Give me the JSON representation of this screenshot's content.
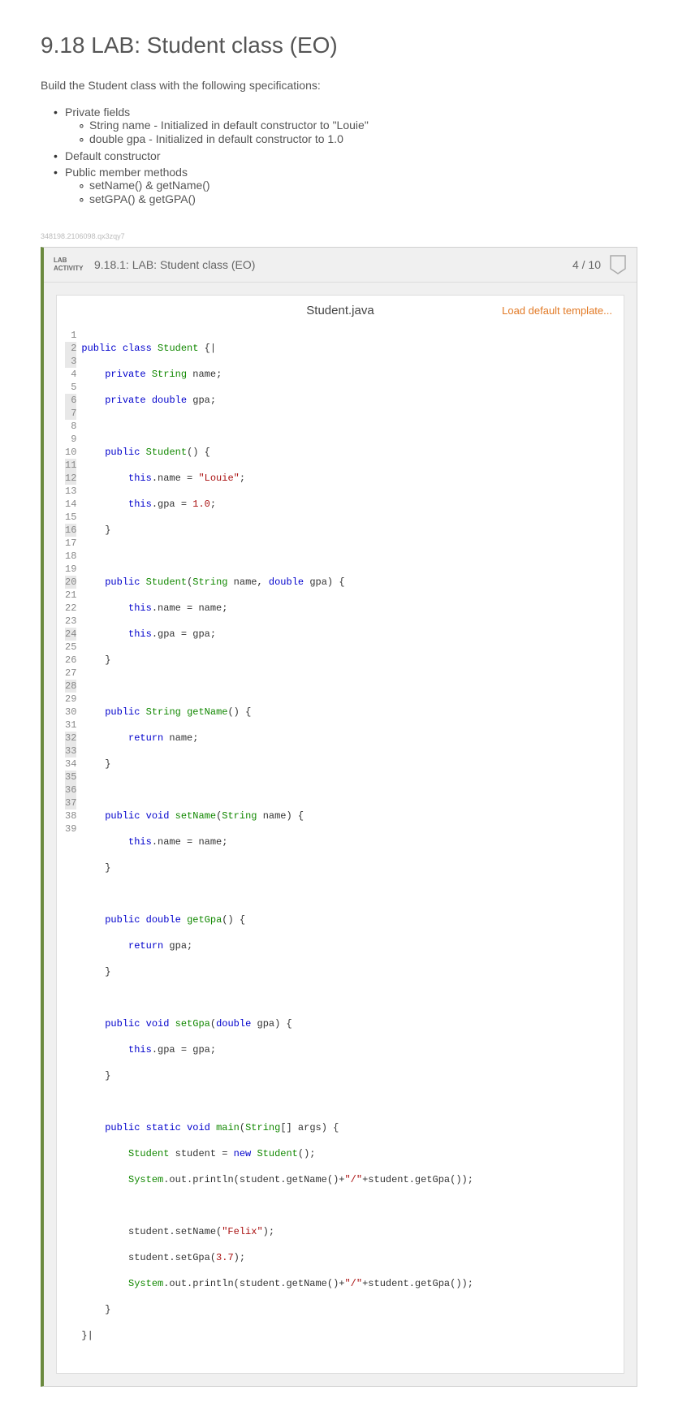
{
  "heading": "9.18 LAB: Student class (EO)",
  "description": "Build the Student class with the following specifications:",
  "specs": {
    "item1": "Private fields",
    "item1a": "String name - Initialized in default constructor to \"Louie\"",
    "item1b": "double gpa - Initialized in default constructor to 1.0",
    "item2": "Default constructor",
    "item3": "Public member methods",
    "item3a": "setName() & getName()",
    "item3b": "setGPA() & getGPA()"
  },
  "hash": "348198.2106098.qx3zqy7",
  "activity": {
    "label_line1": "LAB",
    "label_line2": "ACTIVITY",
    "title": "9.18.1: LAB: Student class (EO)",
    "score": "4 / 10"
  },
  "editor": {
    "filename": "Student.java",
    "load_template": "Load default template..."
  },
  "code_lines": 39,
  "code_tokens": {
    "l1": {
      "a": "public",
      "b": "class",
      "c": "Student",
      "d": "{|"
    },
    "l2": {
      "a": "private",
      "b": "String",
      "c": "name;"
    },
    "l3": {
      "a": "private",
      "b": "double",
      "c": "gpa;"
    },
    "l5": {
      "a": "public",
      "b": "Student",
      "c": "() {"
    },
    "l6": {
      "a": "this",
      "b": ".name = ",
      "c": "\"Louie\"",
      "d": ";"
    },
    "l7": {
      "a": "this",
      "b": ".gpa = ",
      "c": "1.0",
      "d": ";"
    },
    "l8": {
      "a": "}"
    },
    "l10": {
      "a": "public",
      "b": "Student",
      "c": "(",
      "d": "String",
      "e": " name, ",
      "f": "double",
      "g": " gpa) {"
    },
    "l11": {
      "a": "this",
      "b": ".name = name;"
    },
    "l12": {
      "a": "this",
      "b": ".gpa = gpa;"
    },
    "l13": {
      "a": "}"
    },
    "l15": {
      "a": "public",
      "b": "String",
      "c": "getName",
      "d": "() {"
    },
    "l16": {
      "a": "return",
      "b": " name;"
    },
    "l17": {
      "a": "}"
    },
    "l19": {
      "a": "public",
      "b": "void",
      "c": "setName",
      "d": "(",
      "e": "String",
      "f": " name) {"
    },
    "l20": {
      "a": "this",
      "b": ".name = name;"
    },
    "l21": {
      "a": "}"
    },
    "l23": {
      "a": "public",
      "b": "double",
      "c": "getGpa",
      "d": "() {"
    },
    "l24": {
      "a": "return",
      "b": " gpa;"
    },
    "l25": {
      "a": "}"
    },
    "l27": {
      "a": "public",
      "b": "void",
      "c": "setGpa",
      "d": "(",
      "e": "double",
      "f": " gpa) {"
    },
    "l28": {
      "a": "this",
      "b": ".gpa = gpa;"
    },
    "l29": {
      "a": "}"
    },
    "l31": {
      "a": "public",
      "b": "static",
      "c": "void",
      "d": "main",
      "e": "(",
      "f": "String",
      "g": "[] args) {"
    },
    "l32": {
      "a": "Student",
      "b": " student = ",
      "c": "new",
      "d": "Student",
      "e": "();"
    },
    "l33": {
      "a": "System",
      "b": ".out.println(student.getName()+",
      "c": "\"/\"",
      "d": "+student.getGpa());"
    },
    "l35": {
      "a": "student.setName(",
      "b": "\"Felix\"",
      "c": ");"
    },
    "l36": {
      "a": "student.setGpa(",
      "b": "3.7",
      "c": ");"
    },
    "l37": {
      "a": "System",
      "b": ".out.println(student.getName()+",
      "c": "\"/\"",
      "d": "+student.getGpa());"
    },
    "l38": {
      "a": "}"
    },
    "l39": {
      "a": "}|"
    }
  },
  "highlighted_gutter_lines": [
    2,
    3,
    6,
    7,
    11,
    12,
    16,
    20,
    24,
    28,
    32,
    33,
    35,
    36,
    37
  ]
}
